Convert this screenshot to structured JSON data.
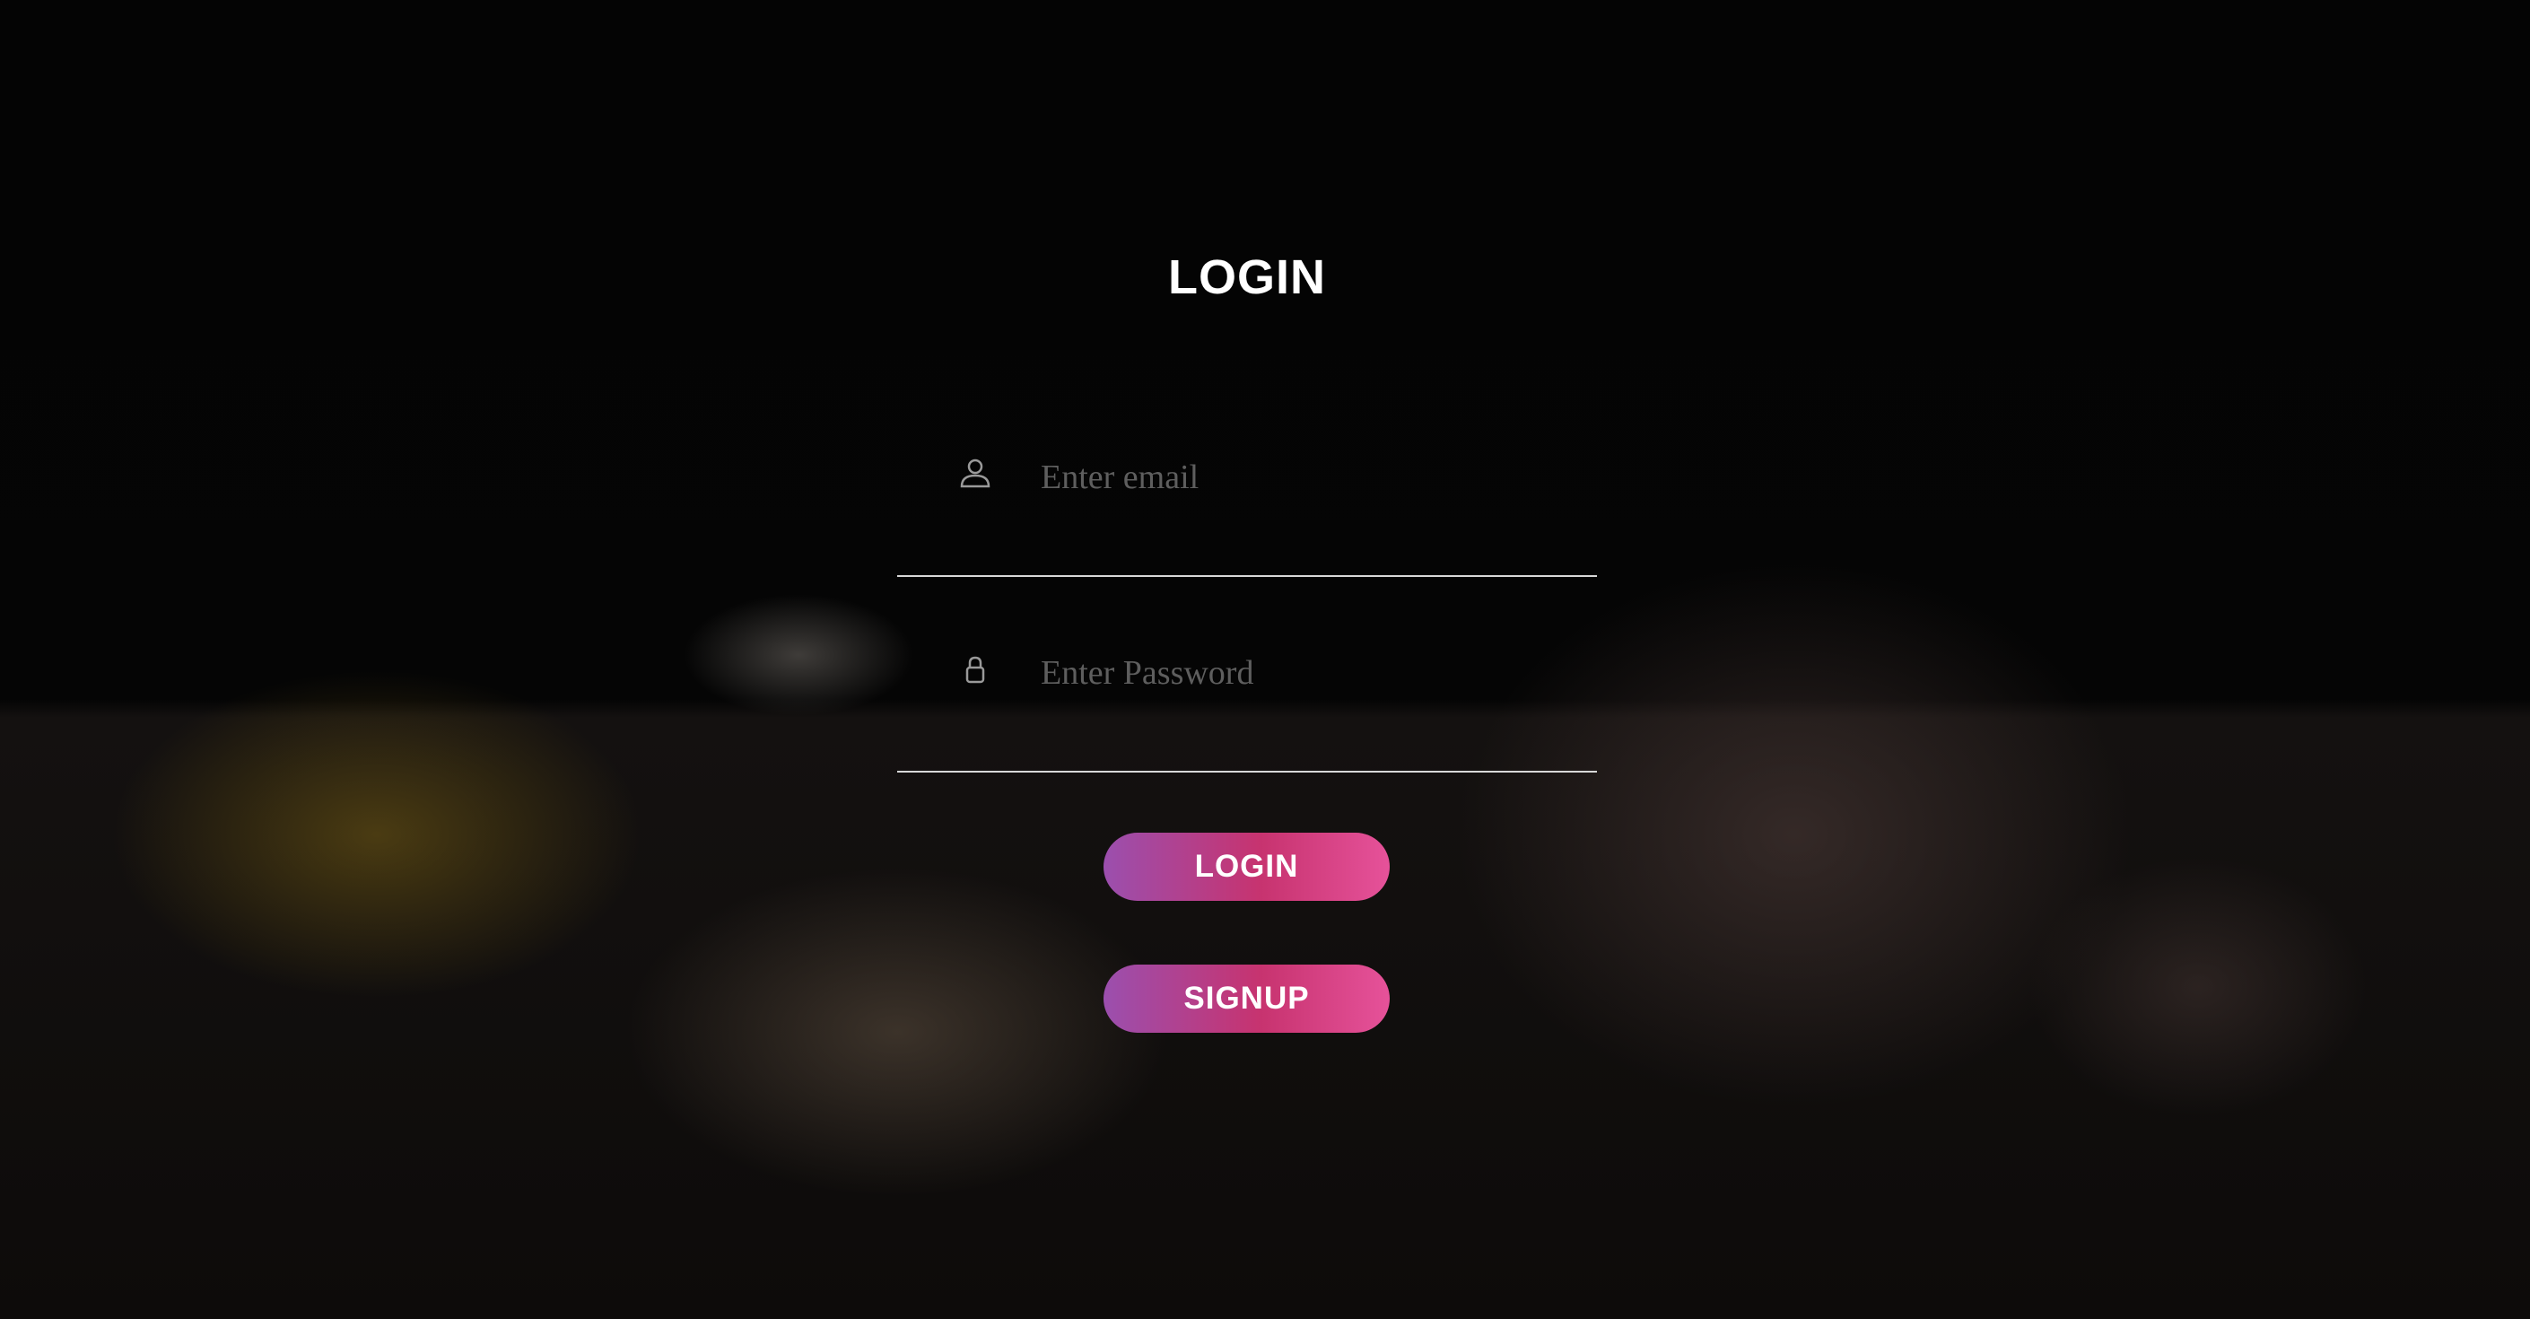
{
  "form": {
    "title": "LOGIN",
    "email_placeholder": "Enter email",
    "password_placeholder": "Enter Password",
    "login_label": "LOGIN",
    "signup_label": "SIGNUP"
  },
  "colors": {
    "button_start": "#9b4fae",
    "button_mid": "#c7336f",
    "button_end": "#e6529a"
  }
}
